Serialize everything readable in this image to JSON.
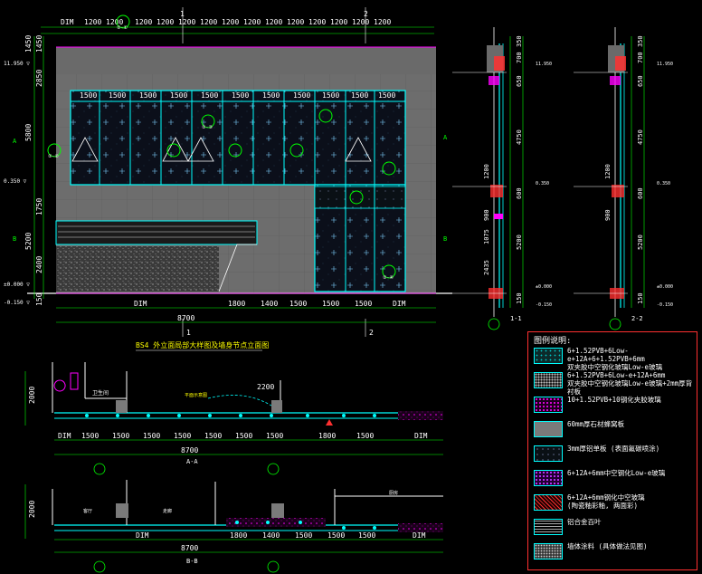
{
  "elevation": {
    "title": "BS4 外立面局部大样图及墙身节点立面图",
    "top_dims": [
      "DIM",
      "1200",
      "1200",
      "1200",
      "1200",
      "1200",
      "1200",
      "1200",
      "1200",
      "1200",
      "1200",
      "1200",
      "1200",
      "1200",
      "1200"
    ],
    "panel_dims": [
      "1500",
      "1500",
      "1500",
      "1500",
      "1500",
      "1500",
      "1500",
      "1500",
      "1500",
      "1500",
      "1500",
      "1500",
      "1500"
    ],
    "left_dims": [
      "1450",
      "1450",
      "2850",
      "5800",
      "1750",
      "5200",
      "2400",
      "150"
    ],
    "level_marks": [
      "11.950 ▽",
      "0.350 ▽",
      "±0.000 ▽",
      "-0.150 ▽"
    ],
    "axis_left": [
      "A",
      "B"
    ],
    "axis_bottom": [
      "1",
      "2"
    ],
    "axis_top": [
      "1",
      "2"
    ],
    "bottom_dims": [
      "DIM",
      "1800",
      "1400",
      "1500",
      "1500",
      "1500",
      "DIM"
    ],
    "total_width": "8700",
    "callouts": [
      "②-①",
      "②-②",
      "②-③",
      "②-④"
    ]
  },
  "sections": {
    "labels": [
      "1-1",
      "2-2"
    ],
    "dims_1": [
      "350",
      "700",
      "650",
      "4750",
      "1200",
      "600",
      "900",
      "1075",
      "2435",
      "5200",
      "150"
    ],
    "dims_2": [
      "350",
      "700",
      "650",
      "4750",
      "1200",
      "600",
      "900",
      "5200",
      "150"
    ],
    "levels": [
      "11.950",
      "0.350",
      "±0.000",
      "-0.150"
    ]
  },
  "plan_a": {
    "label": "A-A",
    "height_dim": "2000",
    "dims": [
      "DIM",
      "1500",
      "1500",
      "1500",
      "1500",
      "1500",
      "1500",
      "1500",
      "1800",
      "1500",
      "DIM"
    ],
    "total": "8700",
    "note": "2200",
    "room_labels": [
      "卫生间",
      "平面示意图"
    ]
  },
  "plan_b": {
    "label": "B-B",
    "height_dim": "2000",
    "dims": [
      "DIM",
      "1800",
      "1400",
      "1500",
      "1500",
      "1500",
      "DIM"
    ],
    "total": "8700",
    "room_labels": [
      "客厅",
      "走廊",
      "厨房"
    ]
  },
  "legend": {
    "title": "图例说明:",
    "items": [
      {
        "text": "6+1.52PVB+6Low-e+12A+6+1.52PVB+6mm\n双夹胶中空钢化玻璃Low-e玻璃",
        "pattern": "dots-cyan"
      },
      {
        "text": "6+1.52PVB+6Low-e+12A+6mm\n双夹胶中空钢化玻璃Low-e玻璃+2mm厚背衬板",
        "pattern": "dots-dense"
      },
      {
        "text": "10+1.52PVB+10钢化夹胶玻璃",
        "pattern": "dots-magenta"
      },
      {
        "text": "60mm厚石材蜂窝板",
        "pattern": "grey"
      },
      {
        "text": "3mm厚铝单板 (表面氟碳喷涂)",
        "pattern": "dots-sparse"
      },
      {
        "text": "6+12A+6mm中空钢化Low-e玻璃",
        "pattern": "dots-purple"
      },
      {
        "text": "6+12A+6mm钢化中空玻璃\n(陶瓷釉彩釉, 两面彩)",
        "pattern": "hatch-red"
      },
      {
        "text": "铝合金百叶",
        "pattern": "lines"
      },
      {
        "text": "墙体涂料 (具体做法见图)",
        "pattern": "dots-grey"
      }
    ]
  }
}
